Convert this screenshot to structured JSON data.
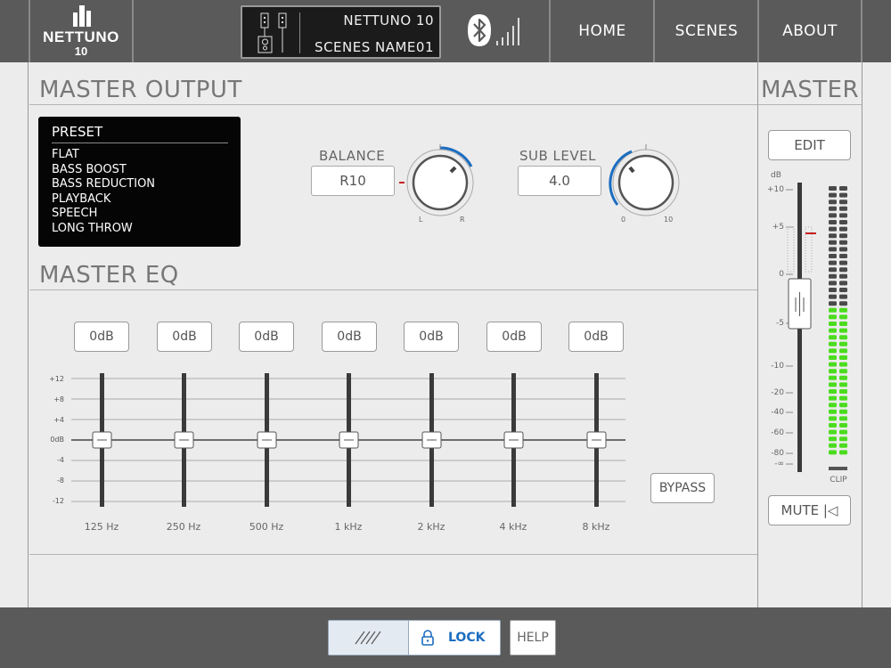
{
  "header": {
    "logo_text": "NETTUNO",
    "logo_number": "10",
    "device_name": "NETTUNO 10",
    "scene_name": "SCENES NAME01",
    "nav": [
      {
        "label": "HOME"
      },
      {
        "label": "SCENES"
      },
      {
        "label": "ABOUT"
      }
    ]
  },
  "master_output": {
    "title": "MASTER OUTPUT",
    "preset": {
      "title": "PRESET",
      "items": [
        "FLAT",
        "BASS BOOST",
        "BASS REDUCTION",
        "PLAYBACK",
        "SPEECH",
        "LONG THROW"
      ]
    },
    "balance": {
      "label": "BALANCE",
      "value": "R10",
      "min_label": "L",
      "max_label": "R",
      "accent": "#1a6cc0"
    },
    "sub_level": {
      "label": "SUB LEVEL",
      "value": "4.0",
      "min_label": "0",
      "max_label": "10",
      "accent": "#1a6cc0"
    }
  },
  "master_eq": {
    "title": "MASTER EQ",
    "scale": [
      "+12",
      "+8",
      "+4",
      "0dB",
      "-4",
      "-8",
      "-12"
    ],
    "bands": [
      {
        "gain": "0dB",
        "freq": "125 Hz"
      },
      {
        "gain": "0dB",
        "freq": "250 Hz"
      },
      {
        "gain": "0dB",
        "freq": "500 Hz"
      },
      {
        "gain": "0dB",
        "freq": "1 kHz"
      },
      {
        "gain": "0dB",
        "freq": "2 kHz"
      },
      {
        "gain": "0dB",
        "freq": "4 kHz"
      },
      {
        "gain": "0dB",
        "freq": "8 kHz"
      }
    ],
    "bypass_label": "BYPASS"
  },
  "master": {
    "title": "MASTER",
    "edit_label": "EDIT",
    "db_unit": "dB",
    "fader_scale": [
      "+10",
      "+5",
      "0",
      "-5",
      "-10",
      "-20",
      "-40",
      "-60",
      "-80",
      "-∞"
    ],
    "clip_label": "CLIP",
    "mute_label": "MUTE |◁",
    "meter_green": "#4bdc1e",
    "meter_off": "#4a4a4a"
  },
  "footer": {
    "lock_label": "LOCK",
    "help_label": "HELP"
  }
}
